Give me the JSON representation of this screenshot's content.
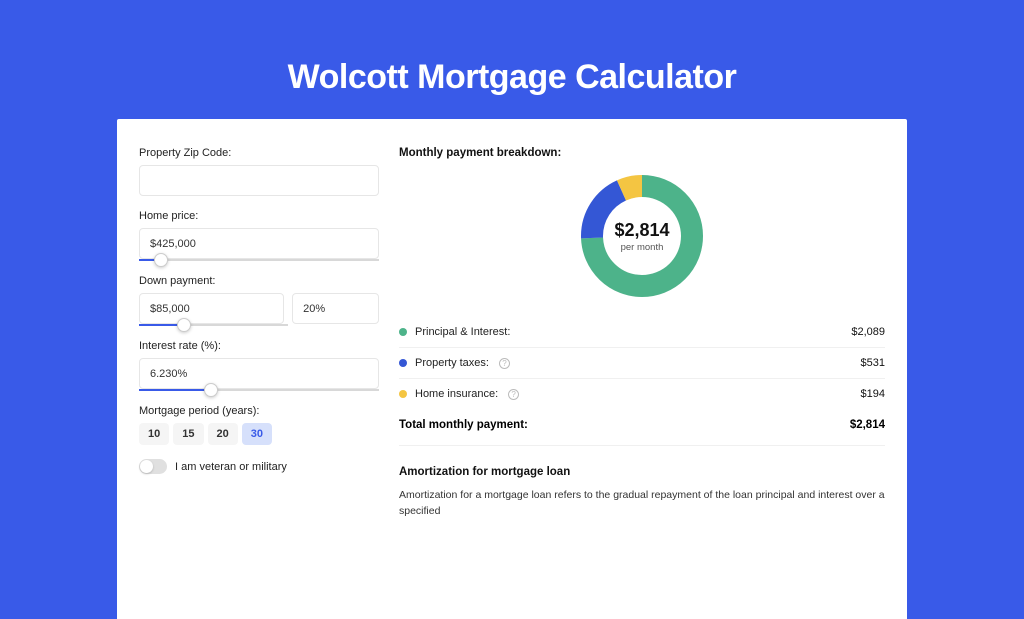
{
  "page_title": "Wolcott Mortgage Calculator",
  "colors": {
    "accent": "#395AE8",
    "green": "#4DB38A",
    "blue": "#3457D5",
    "yellow": "#F4C542"
  },
  "form": {
    "zip_label": "Property Zip Code:",
    "zip_value": "",
    "home_price_label": "Home price:",
    "home_price_value": "$425,000",
    "home_price_slider_pct": 9,
    "down_payment_label": "Down payment:",
    "down_payment_value": "$85,000",
    "down_payment_pct": "20%",
    "down_payment_slider_pct": 30,
    "interest_label": "Interest rate (%):",
    "interest_value": "6.230%",
    "interest_slider_pct": 30,
    "period_label": "Mortgage period (years):",
    "periods": [
      "10",
      "15",
      "20",
      "30"
    ],
    "period_selected": "30",
    "veteran_label": "I am veteran or military",
    "veteran_on": false
  },
  "breakdown": {
    "heading": "Monthly payment breakdown:",
    "total_amount": "$2,814",
    "per_month": "per month",
    "items": [
      {
        "label": "Principal & Interest:",
        "value": "$2,089",
        "info": false,
        "color": "green"
      },
      {
        "label": "Property taxes:",
        "value": "$531",
        "info": true,
        "color": "blue"
      },
      {
        "label": "Home insurance:",
        "value": "$194",
        "info": true,
        "color": "yellow"
      }
    ],
    "total_label": "Total monthly payment:",
    "total_value": "$2,814"
  },
  "chart_data": {
    "type": "pie",
    "title": "Monthly payment breakdown",
    "series": [
      {
        "name": "Principal & Interest",
        "value": 2089,
        "color": "#4DB38A"
      },
      {
        "name": "Property taxes",
        "value": 531,
        "color": "#3457D5"
      },
      {
        "name": "Home insurance",
        "value": 194,
        "color": "#F4C542"
      }
    ],
    "total": 2814,
    "center_label": "$2,814",
    "center_sublabel": "per month"
  },
  "amortization": {
    "heading": "Amortization for mortgage loan",
    "text": "Amortization for a mortgage loan refers to the gradual repayment of the loan principal and interest over a specified"
  }
}
